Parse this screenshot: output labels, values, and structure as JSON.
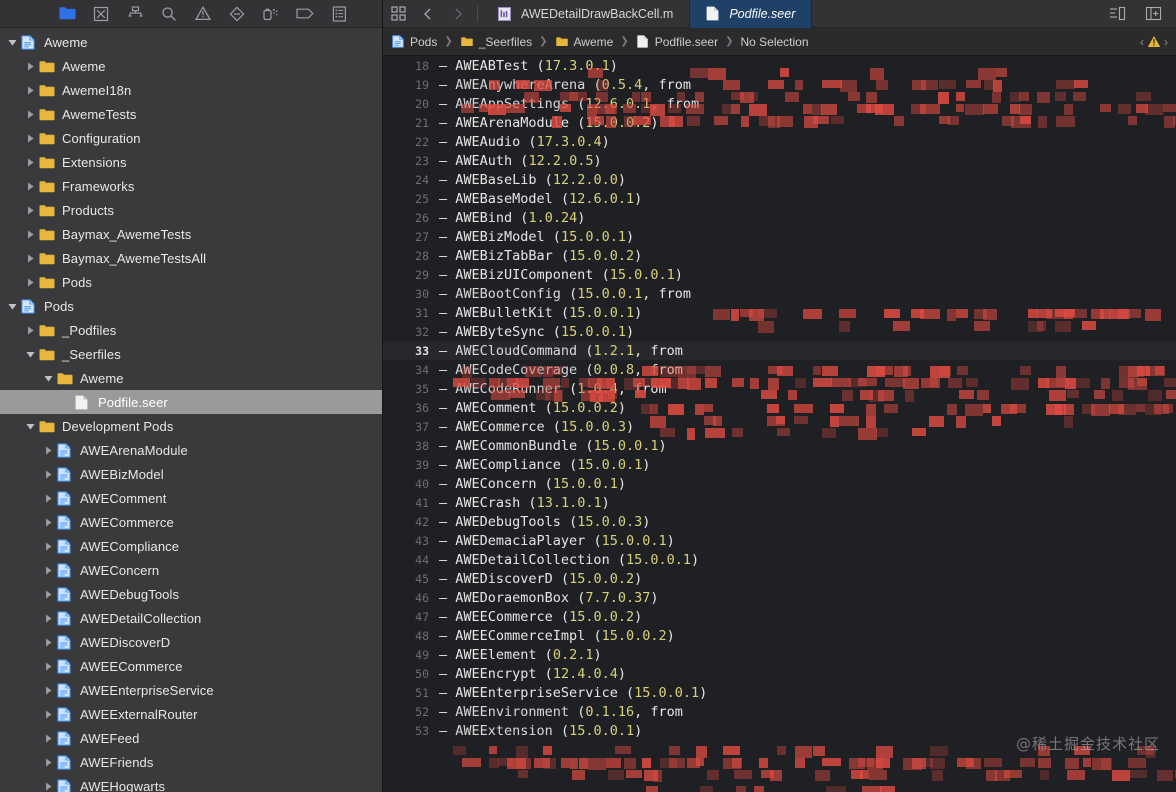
{
  "colors": {
    "sidebar_bg": "#3a3a3c",
    "editor_bg": "#1f2023",
    "tab_active_bg": "#1f4168",
    "folder_yellow": "#e8b63c",
    "file_blue": "#4a9eff",
    "version_yellow": "#d9d07a",
    "selection_gray": "#9a9a9a",
    "redaction_red": "#e04b42"
  },
  "navigator_toolbar": {
    "icons": [
      {
        "name": "folder-navigator-icon",
        "label": "Project navigator",
        "active": true
      },
      {
        "name": "source-control-navigator-icon",
        "label": "Source control navigator",
        "active": false
      },
      {
        "name": "symbol-navigator-icon",
        "label": "Symbol navigator",
        "active": false
      },
      {
        "name": "search-navigator-icon",
        "label": "Find navigator",
        "active": false
      },
      {
        "name": "warning-triangle-icon",
        "label": "Issue navigator",
        "active": false
      },
      {
        "name": "diamond-test-icon",
        "label": "Test navigator",
        "active": false
      },
      {
        "name": "debug-navigator-icon",
        "label": "Debug navigator",
        "active": false
      },
      {
        "name": "breakpoint-tag-icon",
        "label": "Breakpoint navigator",
        "active": false
      },
      {
        "name": "report-navigator-icon",
        "label": "Report navigator",
        "active": false
      }
    ]
  },
  "sidebar": {
    "items": [
      {
        "label": "Aweme",
        "depth": 0,
        "icon": "project",
        "twisty": "open",
        "selected": false
      },
      {
        "label": "Aweme",
        "depth": 1,
        "icon": "folder",
        "twisty": "closed",
        "selected": false
      },
      {
        "label": "AwemeI18n",
        "depth": 1,
        "icon": "folder",
        "twisty": "closed",
        "selected": false
      },
      {
        "label": "AwemeTests",
        "depth": 1,
        "icon": "folder",
        "twisty": "closed",
        "selected": false
      },
      {
        "label": "Configuration",
        "depth": 1,
        "icon": "folder",
        "twisty": "closed",
        "selected": false
      },
      {
        "label": "Extensions",
        "depth": 1,
        "icon": "folder",
        "twisty": "closed",
        "selected": false
      },
      {
        "label": "Frameworks",
        "depth": 1,
        "icon": "folder",
        "twisty": "closed",
        "selected": false
      },
      {
        "label": "Products",
        "depth": 1,
        "icon": "folder",
        "twisty": "closed",
        "selected": false
      },
      {
        "label": "Baymax_AwemeTests",
        "depth": 1,
        "icon": "folder",
        "twisty": "closed",
        "selected": false
      },
      {
        "label": "Baymax_AwemeTestsAll",
        "depth": 1,
        "icon": "folder",
        "twisty": "closed",
        "selected": false
      },
      {
        "label": "Pods",
        "depth": 1,
        "icon": "folder",
        "twisty": "closed",
        "selected": false
      },
      {
        "label": "Pods",
        "depth": 0,
        "icon": "project",
        "twisty": "open",
        "selected": false
      },
      {
        "label": "_Podfiles",
        "depth": 1,
        "icon": "folder",
        "twisty": "closed",
        "selected": false
      },
      {
        "label": "_Seerfiles",
        "depth": 1,
        "icon": "folder",
        "twisty": "open",
        "selected": false
      },
      {
        "label": "Aweme",
        "depth": 2,
        "icon": "folder",
        "twisty": "open",
        "selected": false
      },
      {
        "label": "Podfile.seer",
        "depth": 3,
        "icon": "file-white",
        "twisty": "none",
        "selected": true
      },
      {
        "label": "Development Pods",
        "depth": 1,
        "icon": "folder",
        "twisty": "open",
        "selected": false
      },
      {
        "label": "AWEArenaModule",
        "depth": 2,
        "icon": "file-blue",
        "twisty": "closed",
        "selected": false
      },
      {
        "label": "AWEBizModel",
        "depth": 2,
        "icon": "file-blue",
        "twisty": "closed",
        "selected": false
      },
      {
        "label": "AWEComment",
        "depth": 2,
        "icon": "file-blue",
        "twisty": "closed",
        "selected": false
      },
      {
        "label": "AWECommerce",
        "depth": 2,
        "icon": "file-blue",
        "twisty": "closed",
        "selected": false
      },
      {
        "label": "AWECompliance",
        "depth": 2,
        "icon": "file-blue",
        "twisty": "closed",
        "selected": false
      },
      {
        "label": "AWEConcern",
        "depth": 2,
        "icon": "file-blue",
        "twisty": "closed",
        "selected": false
      },
      {
        "label": "AWEDebugTools",
        "depth": 2,
        "icon": "file-blue",
        "twisty": "closed",
        "selected": false
      },
      {
        "label": "AWEDetailCollection",
        "depth": 2,
        "icon": "file-blue",
        "twisty": "closed",
        "selected": false
      },
      {
        "label": "AWEDiscoverD",
        "depth": 2,
        "icon": "file-blue",
        "twisty": "closed",
        "selected": false
      },
      {
        "label": "AWEECommerce",
        "depth": 2,
        "icon": "file-blue",
        "twisty": "closed",
        "selected": false
      },
      {
        "label": "AWEEnterpriseService",
        "depth": 2,
        "icon": "file-blue",
        "twisty": "closed",
        "selected": false
      },
      {
        "label": "AWEExternalRouter",
        "depth": 2,
        "icon": "file-blue",
        "twisty": "closed",
        "selected": false
      },
      {
        "label": "AWEFeed",
        "depth": 2,
        "icon": "file-blue",
        "twisty": "closed",
        "selected": false
      },
      {
        "label": "AWEFriends",
        "depth": 2,
        "icon": "file-blue",
        "twisty": "closed",
        "selected": false
      },
      {
        "label": "AWEHogwarts",
        "depth": 2,
        "icon": "file-blue",
        "twisty": "closed",
        "selected": false
      }
    ]
  },
  "tabbar": {
    "grid_icon": "tab-overview-icon",
    "back_icon": "chevron-left-icon",
    "forward_icon": "chevron-right-icon",
    "tabs": [
      {
        "label": "AWEDetailDrawBackCell.m",
        "icon": "objc-file-icon",
        "active": false
      },
      {
        "label": "Podfile.seer",
        "icon": "file-white-icon",
        "active": true
      }
    ],
    "right_icons": [
      {
        "name": "inspector-toggle-icon"
      },
      {
        "name": "add-editor-icon"
      }
    ]
  },
  "breadcrumb": {
    "crumbs": [
      {
        "label": "Pods",
        "icon": "project-icon"
      },
      {
        "label": "_Seerfiles",
        "icon": "folder-icon"
      },
      {
        "label": "Aweme",
        "icon": "folder-icon"
      },
      {
        "label": "Podfile.seer",
        "icon": "file-white-icon"
      },
      {
        "label": "No Selection",
        "icon": "none"
      }
    ],
    "right": {
      "prev_icon": "chevron-left-icon",
      "warning_icon": "warning-triangle-icon",
      "next_icon": "chevron-right-icon"
    }
  },
  "code": {
    "current_line": 33,
    "lines": [
      {
        "n": 18,
        "name": "AWEABTest",
        "ver": "17.3.0.1",
        "redacted": false,
        "clipped_top": true
      },
      {
        "n": 19,
        "name": "AWEAnywhereArena",
        "ver": "0.5.4",
        "redacted": true,
        "from": true
      },
      {
        "n": 20,
        "name": "AWEAppSettings",
        "ver": "12.6.0.1",
        "redacted": true,
        "from": true
      },
      {
        "n": 21,
        "name": "AWEArenaModule",
        "ver": "15.0.0.2",
        "redacted": false
      },
      {
        "n": 22,
        "name": "AWEAudio",
        "ver": "17.3.0.4",
        "redacted": false
      },
      {
        "n": 23,
        "name": "AWEAuth",
        "ver": "12.2.0.5",
        "redacted": false
      },
      {
        "n": 24,
        "name": "AWEBaseLib",
        "ver": "12.2.0.0",
        "redacted": false
      },
      {
        "n": 25,
        "name": "AWEBaseModel",
        "ver": "12.6.0.1",
        "redacted": false
      },
      {
        "n": 26,
        "name": "AWEBind",
        "ver": "1.0.24",
        "redacted": false
      },
      {
        "n": 27,
        "name": "AWEBizModel",
        "ver": "15.0.0.1",
        "redacted": false
      },
      {
        "n": 28,
        "name": "AWEBizTabBar",
        "ver": "15.0.0.2",
        "redacted": false
      },
      {
        "n": 29,
        "name": "AWEBizUIComponent",
        "ver": "15.0.0.1",
        "redacted": false
      },
      {
        "n": 30,
        "name": "AWEBootConfig",
        "ver": "15.0.0.1",
        "redacted": true,
        "from": true
      },
      {
        "n": 31,
        "name": "AWEBulletKit",
        "ver": "15.0.0.1",
        "redacted": false
      },
      {
        "n": 32,
        "name": "AWEByteSync",
        "ver": "15.0.0.1",
        "redacted": false
      },
      {
        "n": 33,
        "name": "AWECloudCommand",
        "ver": "1.2.1",
        "redacted": true,
        "from": true
      },
      {
        "n": 34,
        "name": "AWECodeCoverage",
        "ver": "0.0.8",
        "redacted": true,
        "from": true
      },
      {
        "n": 35,
        "name": "AWECodeRunner",
        "ver": "1.0.4",
        "redacted": true,
        "from": true
      },
      {
        "n": 36,
        "name": "AWEComment",
        "ver": "15.0.0.2",
        "redacted": false
      },
      {
        "n": 37,
        "name": "AWECommerce",
        "ver": "15.0.0.3",
        "redacted": false
      },
      {
        "n": 38,
        "name": "AWECommonBundle",
        "ver": "15.0.0.1",
        "redacted": false
      },
      {
        "n": 39,
        "name": "AWECompliance",
        "ver": "15.0.0.1",
        "redacted": false
      },
      {
        "n": 40,
        "name": "AWEConcern",
        "ver": "15.0.0.1",
        "redacted": false
      },
      {
        "n": 41,
        "name": "AWECrash",
        "ver": "13.1.0.1",
        "redacted": false
      },
      {
        "n": 42,
        "name": "AWEDebugTools",
        "ver": "15.0.0.3",
        "redacted": false
      },
      {
        "n": 43,
        "name": "AWEDemaciaPlayer",
        "ver": "15.0.0.1",
        "redacted": false
      },
      {
        "n": 44,
        "name": "AWEDetailCollection",
        "ver": "15.0.0.1",
        "redacted": false
      },
      {
        "n": 45,
        "name": "AWEDiscoverD",
        "ver": "15.0.0.2",
        "redacted": false
      },
      {
        "n": 46,
        "name": "AWEDoraemonBox",
        "ver": "7.7.0.37",
        "redacted": false
      },
      {
        "n": 47,
        "name": "AWEECommerce",
        "ver": "15.0.0.2",
        "redacted": false
      },
      {
        "n": 48,
        "name": "AWEECommerceImpl",
        "ver": "15.0.0.2",
        "redacted": false
      },
      {
        "n": 49,
        "name": "AWEElement",
        "ver": "0.2.1",
        "redacted": false
      },
      {
        "n": 50,
        "name": "AWEEncrypt",
        "ver": "12.4.0.4",
        "redacted": false
      },
      {
        "n": 51,
        "name": "AWEEnterpriseService",
        "ver": "15.0.0.1",
        "redacted": false
      },
      {
        "n": 52,
        "name": "AWEEnvironment",
        "ver": "0.1.16",
        "redacted": true,
        "from": true
      },
      {
        "n": 53,
        "name": "AWEExtension",
        "ver": "15.0.0.1",
        "redacted": true
      }
    ]
  },
  "watermark": "@稀土掘金技术社区"
}
